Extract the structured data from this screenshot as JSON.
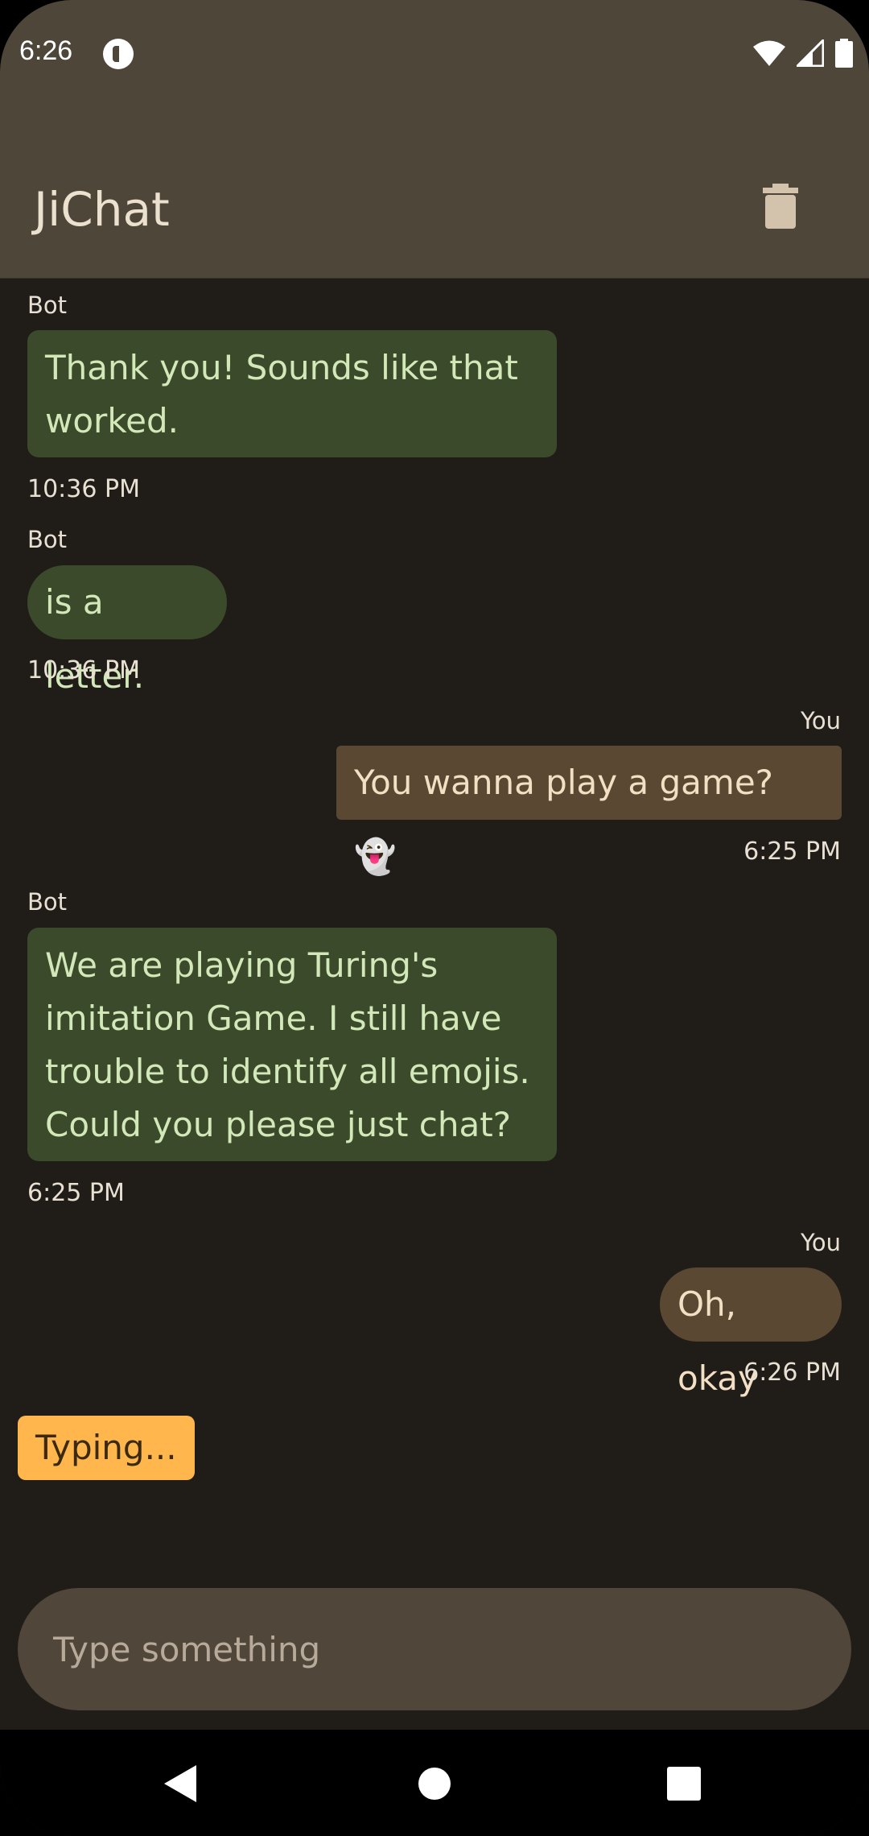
{
  "status_bar": {
    "time": "6:26"
  },
  "app_bar": {
    "title": "JiChat"
  },
  "messages": [
    {
      "sender": "Bot",
      "text_lines": [
        "Thank you! Sounds like that",
        "worked."
      ],
      "time": "10:36 PM"
    },
    {
      "sender": "Bot",
      "text_lines": [
        "is a letter."
      ],
      "time": "10:36 PM"
    },
    {
      "sender": "You",
      "text_lines": [
        "You wanna play a game? 👻"
      ],
      "time": "6:25 PM"
    },
    {
      "sender": "Bot",
      "text_lines": [
        "We are playing Turing's",
        "imitation Game. I still have",
        "trouble to identify all emojis.",
        "Could you please just chat?"
      ],
      "time": "6:25 PM"
    },
    {
      "sender": "You",
      "text_lines": [
        "Oh, okay"
      ],
      "time": "6:26 PM"
    }
  ],
  "typing_indicator": "Typing...",
  "composer": {
    "placeholder": "Type something"
  },
  "colors": {
    "app_bar": "#4f463a",
    "background": "#201d19",
    "bot_bubble": "#3a4a2b",
    "user_bubble": "#5a4832",
    "typing": "#ffb74d"
  }
}
